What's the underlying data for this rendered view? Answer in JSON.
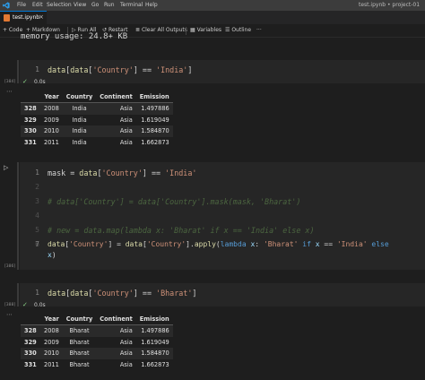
{
  "titlebar": {
    "menus": [
      "File",
      "Edit",
      "Selection",
      "View",
      "Go",
      "Run",
      "Terminal",
      "Help"
    ],
    "window_title": "test.ipynb • project-01"
  },
  "tab": {
    "title": "test.ipynb",
    "close": "×"
  },
  "toolbar": {
    "code": "+ Code",
    "markdown": "+ Markdown",
    "run_all": "Run All",
    "restart": "Restart",
    "clear_all": "Clear All Outputs",
    "variables": "Variables",
    "outline": "Outline",
    "more": "···"
  },
  "output_above": "memory usage: 24.8+ KB",
  "cells": [
    {
      "exec_count": "[384]",
      "status_time": "0.0s",
      "lines": [
        {
          "no": "1",
          "code": "data[data['Country'] == 'India']"
        }
      ],
      "table": {
        "columns": [
          "",
          "Year",
          "Country",
          "Continent",
          "Emission"
        ],
        "rows": [
          [
            "328",
            "2008",
            "India",
            "Asia",
            "1.497886"
          ],
          [
            "329",
            "2009",
            "India",
            "Asia",
            "1.619049"
          ],
          [
            "330",
            "2010",
            "India",
            "Asia",
            "1.584870"
          ],
          [
            "331",
            "2011",
            "India",
            "Asia",
            "1.662873"
          ]
        ]
      }
    },
    {
      "exec_count": "[386]",
      "lines": [
        {
          "no": "1",
          "code": "mask = data['Country'] == 'India'"
        },
        {
          "no": "2",
          "code": ""
        },
        {
          "no": "3",
          "code": "# data['Country'] = data['Country'].mask(mask, 'Bharat')"
        },
        {
          "no": "4",
          "code": ""
        },
        {
          "no": "5",
          "code": "# new = data.map(lambda x: 'Bharat' if x == 'India' else x)"
        },
        {
          "no": "6",
          "code": ""
        },
        {
          "no": "7",
          "code": "data['Country'] = data['Country'].apply(lambda x: 'Bharat' if x == 'India' else"
        },
        {
          "no": "",
          "code": "x)"
        }
      ]
    },
    {
      "exec_count": "[388]",
      "status_time": "0.0s",
      "lines": [
        {
          "no": "1",
          "code": "data[data['Country'] == 'Bharat']"
        }
      ],
      "table": {
        "columns": [
          "",
          "Year",
          "Country",
          "Continent",
          "Emission"
        ],
        "rows": [
          [
            "328",
            "2008",
            "Bharat",
            "Asia",
            "1.497886"
          ],
          [
            "329",
            "2009",
            "Bharat",
            "Asia",
            "1.619049"
          ],
          [
            "330",
            "2010",
            "Bharat",
            "Asia",
            "1.584870"
          ],
          [
            "331",
            "2011",
            "Bharat",
            "Asia",
            "1.662873"
          ]
        ]
      }
    }
  ],
  "colors": {
    "background": "#1e1e1e",
    "editor": "#262626",
    "keyword": "#569cd6",
    "string": "#ce9178",
    "comment": "#6a9955",
    "success": "#89d185",
    "accent": "#0078d4"
  },
  "icons": [
    "vscode-icon",
    "notebook-file-icon",
    "play-icon",
    "restart-icon",
    "clear-icon",
    "variables-icon",
    "outline-icon",
    "check-icon",
    "run-cell-icon"
  ]
}
